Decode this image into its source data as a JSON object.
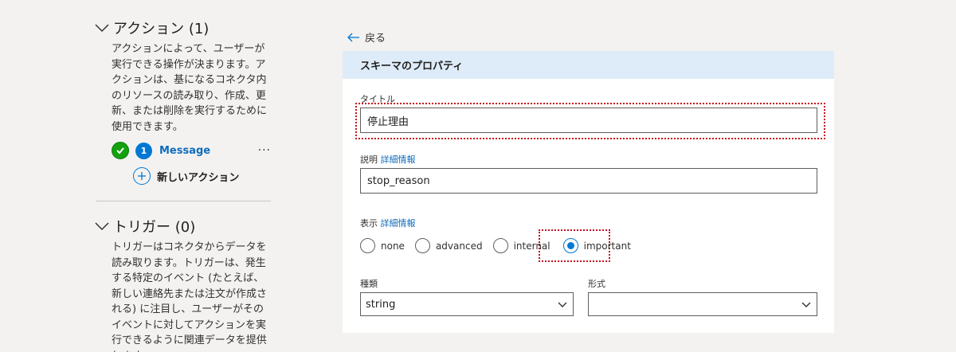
{
  "actions": {
    "title": "アクション (1)",
    "description": "アクションによって、ユーザーが実行できる操作が決まります。アクションは、基になるコネクタ内のリソースの読み取り、作成、更新、または削除を実行するために使用できます。",
    "items": [
      {
        "number": "1",
        "label": "Message",
        "more": "···"
      }
    ],
    "new_action_label": "新しいアクション"
  },
  "triggers": {
    "title": "トリガー (0)",
    "description": "トリガーはコネクタからデータを読み取ります。トリガーは、発生する特定のイベント (たとえば、新しい連絡先または注文が作成される) に注目し、ユーザーがそのイベントに対してアクションを実行できるように関連データを提供します。"
  },
  "back_label": "戻る",
  "schema": {
    "header": "スキーマのプロパティ",
    "title_label": "タイトル",
    "title_value": "停止理由",
    "description_label": "説明",
    "description_link": "詳細情報",
    "description_value": "stop_reason",
    "visibility_label": "表示",
    "visibility_link": "詳細情報",
    "visibility_options": [
      "none",
      "advanced",
      "internal",
      "important"
    ],
    "visibility_selected": "important",
    "type_label": "種類",
    "type_value": "string",
    "format_label": "形式",
    "format_value": ""
  },
  "colors": {
    "accent": "#0078d4",
    "header_bg": "#deecf9",
    "success": "#13a10e",
    "highlight_border": "#c50f1f"
  }
}
